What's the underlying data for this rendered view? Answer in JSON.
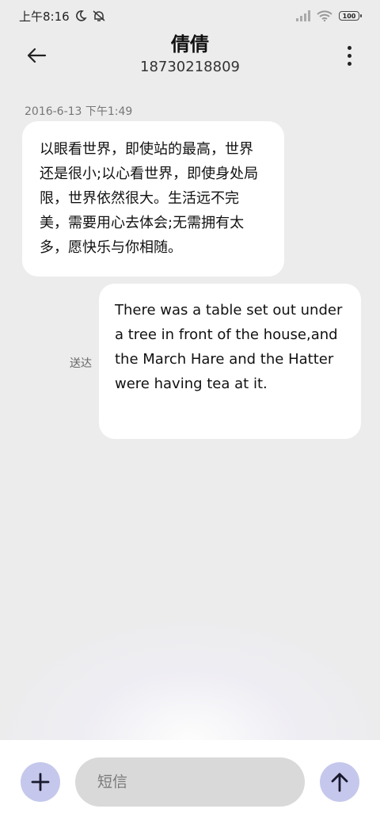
{
  "status_bar": {
    "time": "上午8:16",
    "battery": "100",
    "icons": [
      "moon-icon",
      "mute-icon",
      "signal-icon",
      "wifi-icon",
      "battery-icon"
    ]
  },
  "header": {
    "contact_name": "倩倩",
    "contact_number": "18730218809",
    "icons": [
      "back-arrow-icon",
      "more-vertical-icon"
    ]
  },
  "conversation": {
    "timestamp": "2016-6-13 下午1:49",
    "messages": [
      {
        "direction": "incoming",
        "text": "以眼看世界，即使站的最高，世界还是很小;以心看世界，即使身处局限，世界依然很大。生活远不完美，需要用心去体会;无需拥有太多，愿快乐与你相随。"
      },
      {
        "direction": "outgoing",
        "text": "There was a table set out under a tree in front of the house,and the March Hare and the Hatter were having tea at it.",
        "status": "送达"
      }
    ]
  },
  "composer": {
    "placeholder": "短信",
    "icons": [
      "plus-icon",
      "send-arrow-icon"
    ],
    "accent_color": "#c5c8ec"
  }
}
